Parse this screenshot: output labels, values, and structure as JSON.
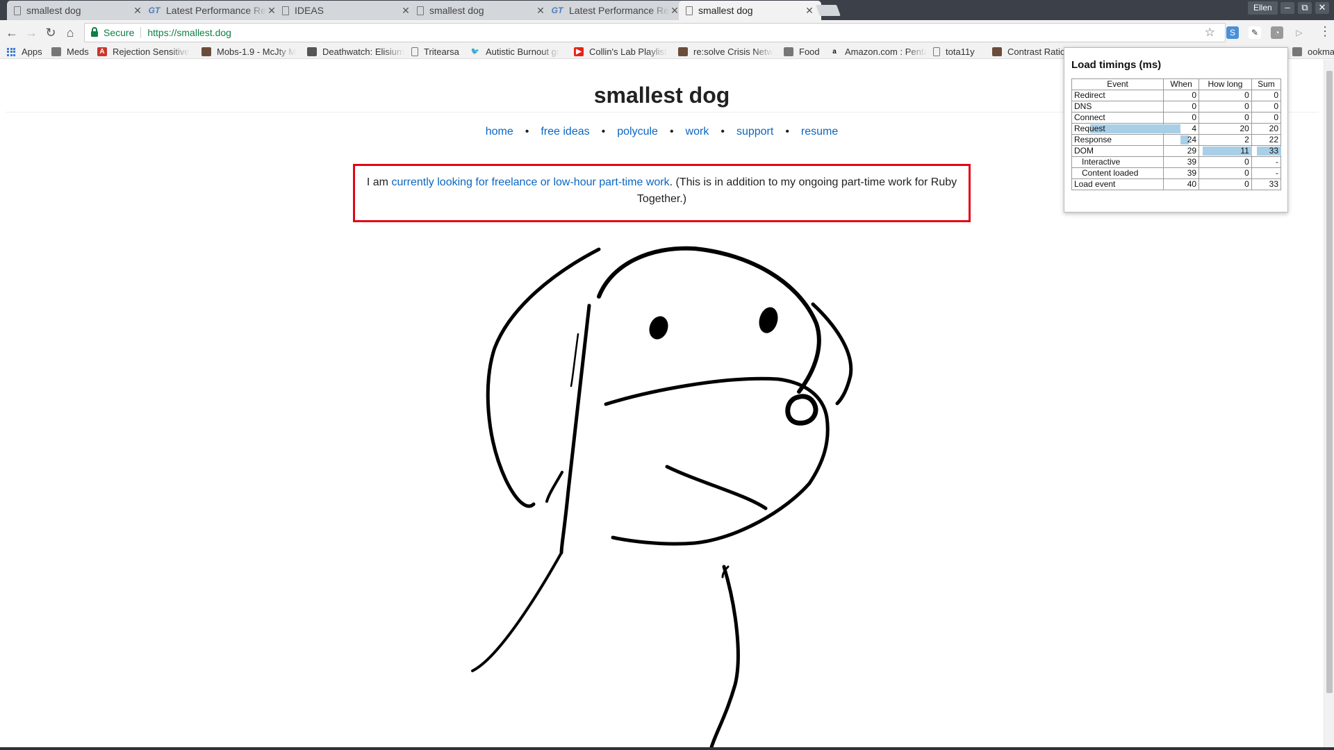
{
  "browser": {
    "tabs": [
      {
        "title": "smallest dog",
        "icon": "document-icon",
        "active": false
      },
      {
        "title": "Latest Performance Re",
        "icon": "gt-icon",
        "active": false
      },
      {
        "title": "IDEAS",
        "icon": "document-icon",
        "active": false
      },
      {
        "title": "smallest dog",
        "icon": "document-icon",
        "active": false
      },
      {
        "title": "Latest Performance Re",
        "icon": "gt-icon",
        "active": false
      },
      {
        "title": "smallest dog",
        "icon": "document-icon",
        "active": true
      }
    ],
    "profile": "Ellen",
    "security_label": "Secure",
    "url": "https://smallest.dog",
    "bookmarks": [
      {
        "label": "Apps",
        "icon": "apps-grid-icon"
      },
      {
        "label": "Meds",
        "icon": "folder-icon"
      },
      {
        "label": "Rejection Sensitive",
        "icon": "a-icon"
      },
      {
        "label": "Mobs-1.9 - McJty M",
        "icon": "site-icon"
      },
      {
        "label": "Deathwatch: Elisium",
        "icon": "cube-icon"
      },
      {
        "label": "Tritearsa",
        "icon": "document-icon"
      },
      {
        "label": "Autistic Burnout gr",
        "icon": "twitter-icon"
      },
      {
        "label": "Collin's Lab Playlist",
        "icon": "youtube-icon"
      },
      {
        "label": "re:solve Crisis Netw",
        "icon": "site-icon"
      },
      {
        "label": "Food",
        "icon": "folder-icon"
      },
      {
        "label": "Amazon.com : Penta",
        "icon": "amazon-icon"
      },
      {
        "label": "tota11y",
        "icon": "document-icon"
      },
      {
        "label": "Contrast Ratio",
        "icon": "site-icon"
      },
      {
        "label": "ookmarks",
        "icon": "folder-icon"
      }
    ]
  },
  "page": {
    "title": "smallest dog",
    "nav": [
      "home",
      "free ideas",
      "polycule",
      "work",
      "support",
      "resume"
    ],
    "notice": {
      "prefix": "I am ",
      "link": "currently looking for freelance or low-hour part-time work",
      "suffix": ". (This is in addition to my ongoing part-time work for Ruby Together.)"
    }
  },
  "popup": {
    "title": "Load timings (ms)",
    "columns": [
      "Event",
      "When",
      "How long",
      "Sum"
    ],
    "rows": [
      {
        "event": "Redirect",
        "when": "0",
        "how_long": "0",
        "sum": "0",
        "indent": false
      },
      {
        "event": "DNS",
        "when": "0",
        "how_long": "0",
        "sum": "0",
        "indent": false
      },
      {
        "event": "Connect",
        "when": "0",
        "how_long": "0",
        "sum": "0",
        "indent": false
      },
      {
        "event": "Request",
        "when": "4",
        "how_long": "20",
        "sum": "20",
        "indent": false
      },
      {
        "event": "Response",
        "when": "24",
        "how_long": "2",
        "sum": "22",
        "indent": false
      },
      {
        "event": "DOM",
        "when": "29",
        "how_long": "11",
        "sum": "33",
        "indent": false
      },
      {
        "event": "Interactive",
        "when": "39",
        "how_long": "0",
        "sum": "-",
        "indent": true
      },
      {
        "event": "Content loaded",
        "when": "39",
        "how_long": "0",
        "sum": "-",
        "indent": true
      },
      {
        "event": "Load event",
        "when": "40",
        "how_long": "0",
        "sum": "33",
        "indent": false
      }
    ]
  },
  "colors": {
    "link": "#0a66c2",
    "notice_border": "#e30613",
    "secure_green": "#0b8043",
    "timing_bar": "#a9cfe6"
  }
}
